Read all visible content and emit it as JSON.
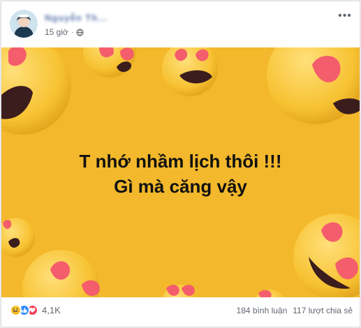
{
  "post": {
    "author_name": "Nguyễn Th...",
    "time": "15 giờ",
    "privacy_icon": "globe-icon",
    "more_icon": "more-options-icon",
    "text_line1": "T nhớ nhầm lịch thôi !!!",
    "text_line2": "Gì mà căng vậy",
    "background_color": "#f3b82b"
  },
  "footer": {
    "reaction_icons": [
      "haha-icon",
      "like-icon",
      "love-icon"
    ],
    "reaction_count": "4,1K",
    "comments": "184 bình luận",
    "shares": "117 lượt chia sẻ"
  }
}
